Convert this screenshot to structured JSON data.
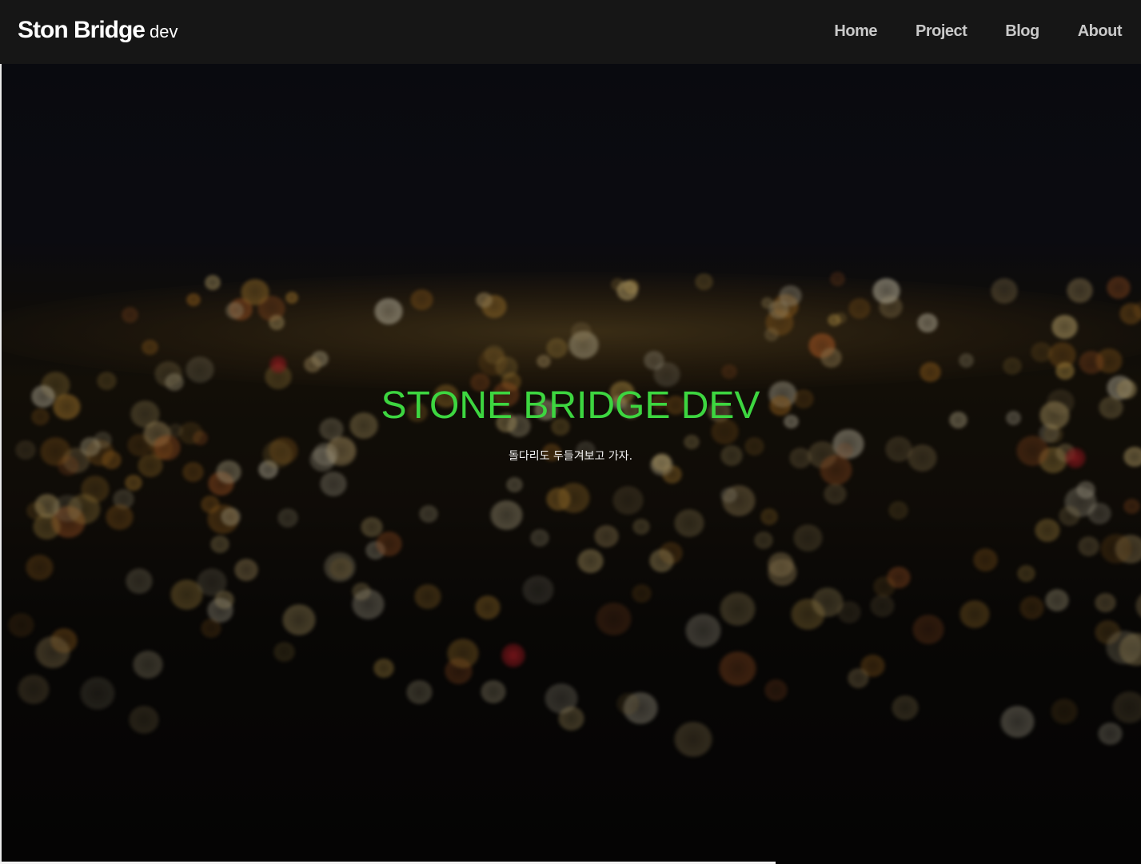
{
  "navbar": {
    "brand_main": "Ston Bridge",
    "brand_sub": "dev",
    "links": [
      "Home",
      "Project",
      "Blog",
      "About"
    ]
  },
  "hero": {
    "title": "STONE BRIDGE DEV",
    "subtitle": "돌다리도 두들겨보고 가자.",
    "background": "night-city-bokeh-image"
  },
  "colors": {
    "navbar_bg": "#161616",
    "title_green": "#3dd640",
    "nav_text": "#c9c9c9"
  }
}
